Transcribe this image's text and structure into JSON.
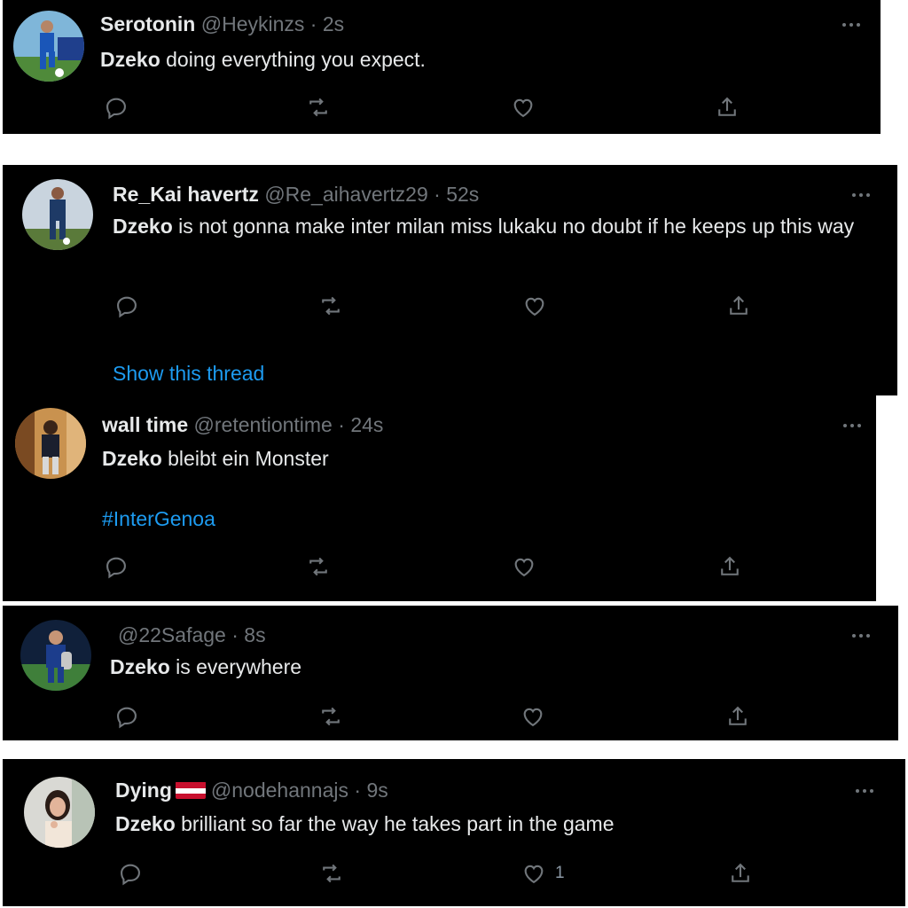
{
  "tweets": [
    {
      "name": "Serotonin",
      "handle": "@Heykinzs",
      "sep": "·",
      "time": "2s",
      "text_bold": "Dzeko",
      "text_rest": " doing everything you expect.",
      "like_count": ""
    },
    {
      "name": "Re_Kai havertz",
      "handle": "@Re_aihavertz29",
      "sep": "·",
      "time": "52s",
      "text_bold": "Dzeko",
      "text_rest": " is not gonna  make inter milan miss lukaku no doubt if he keeps up this way",
      "show_thread": "Show this thread",
      "like_count": ""
    },
    {
      "name": "wall time",
      "handle": "@retentiontime",
      "sep": "·",
      "time": "24s",
      "text_bold": "Dzeko",
      "text_rest": " bleibt ein Monster",
      "hashtag": "#InterGenoa",
      "like_count": ""
    },
    {
      "name": "",
      "handle": "@22Safage",
      "sep": "·",
      "time": "8s",
      "text_bold": "Dzeko",
      "text_rest": " is everywhere",
      "like_count": ""
    },
    {
      "name": "Dying",
      "handle": "@nodehannajs",
      "sep": "·",
      "time": "9s",
      "text_bold": "Dzeko",
      "text_rest": " brilliant so far the way he takes part in the game",
      "like_count": "1"
    }
  ],
  "icons": {
    "reply": "reply-icon",
    "retweet": "retweet-icon",
    "like": "heart-icon",
    "share": "share-icon",
    "more": "more-options-icon"
  },
  "colors": {
    "background": "#000000",
    "text": "#e7e9ea",
    "secondary": "#71767b",
    "link": "#1d9bf0",
    "flag_red": "#c8102e",
    "flag_white": "#ffffff"
  }
}
